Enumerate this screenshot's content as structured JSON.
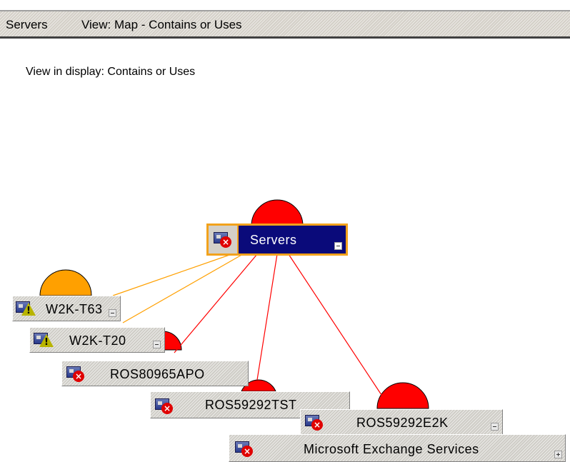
{
  "header": {
    "title": "Servers",
    "view": "View: Map - Contains or Uses"
  },
  "view_line": "View in display: Contains or Uses",
  "colors": {
    "critical": "#ff0000",
    "warning": "#ffa000",
    "selected_bg": "#0a0a7a",
    "selected_border": "#f2a21c"
  },
  "nodes": {
    "root": {
      "label": "Servers",
      "status": "critical",
      "icon": "server-group-icon"
    },
    "w2k_t63": {
      "label": "W2K-T63",
      "status": "warning",
      "icon": "computer-warning-icon"
    },
    "w2k_t20": {
      "label": "W2K-T20",
      "status": "warning",
      "icon": "computer-warning-icon"
    },
    "ros80965apo": {
      "label": "ROS80965APO",
      "status": "critical",
      "icon": "computer-critical-icon"
    },
    "ros59292tst": {
      "label": "ROS59292TST",
      "status": "critical",
      "icon": "computer-critical-icon"
    },
    "ros59292e2k": {
      "label": "ROS59292E2K",
      "status": "critical",
      "icon": "computer-critical-icon"
    },
    "exchange": {
      "label": "Microsoft Exchange Services",
      "status": "critical",
      "icon": "service-critical-icon"
    }
  }
}
